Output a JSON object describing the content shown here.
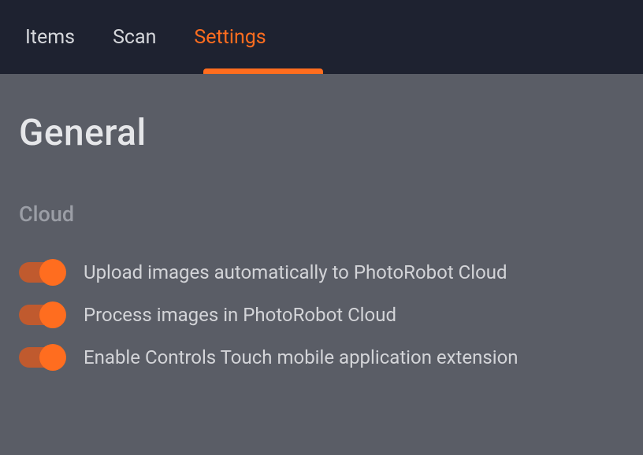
{
  "tabs": {
    "items": [
      {
        "label": "Items",
        "active": false
      },
      {
        "label": "Scan",
        "active": false
      },
      {
        "label": "Settings",
        "active": true
      }
    ]
  },
  "page": {
    "title": "General"
  },
  "sections": {
    "cloud": {
      "title": "Cloud",
      "settings": [
        {
          "label": "Upload images automatically to PhotoRobot Cloud",
          "enabled": true
        },
        {
          "label": "Process images in PhotoRobot Cloud",
          "enabled": true
        },
        {
          "label": "Enable Controls Touch mobile application extension",
          "enabled": true
        }
      ]
    }
  },
  "colors": {
    "accent": "#ff6d1f",
    "tabBackground": "#1e2230",
    "contentBackground": "#5a5d66"
  }
}
